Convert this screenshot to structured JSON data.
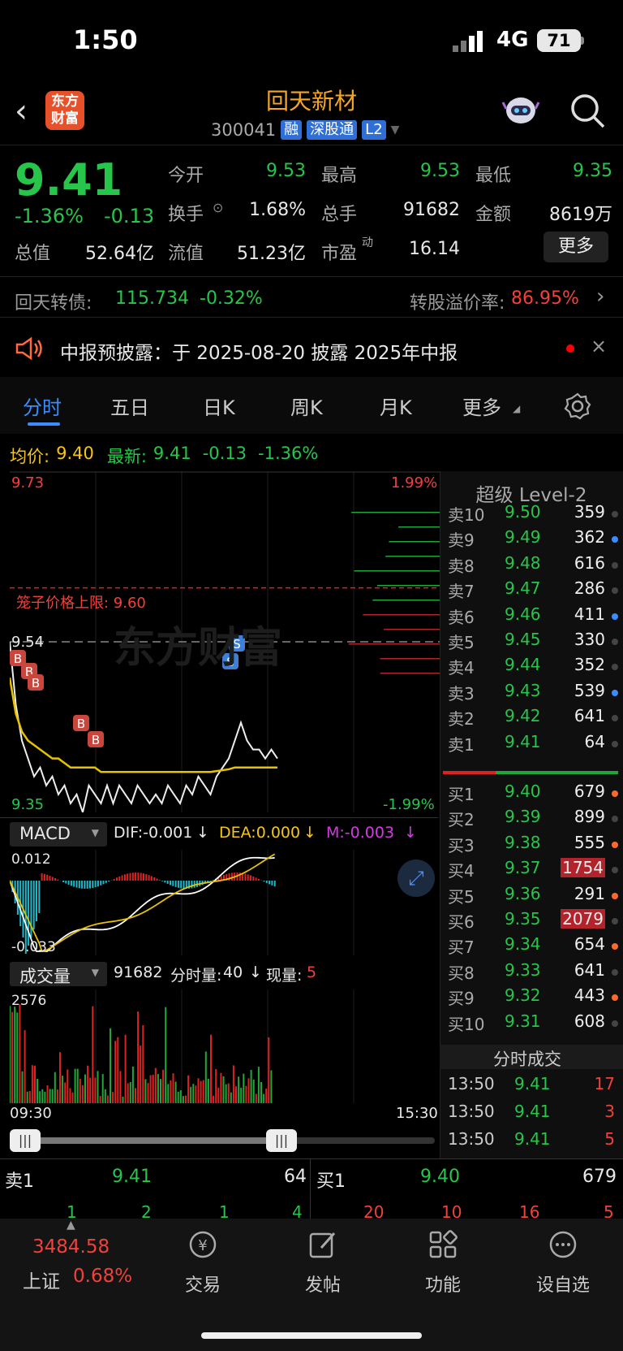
{
  "status": {
    "time": "1:50",
    "network": "4G",
    "battery": "71"
  },
  "header": {
    "logo": "东方财富",
    "title": "回天新材",
    "code": "300041",
    "tags": [
      "融",
      "深股通",
      "L2"
    ]
  },
  "quote": {
    "price": "9.41",
    "change_pct": "-1.36%",
    "change": "-0.13",
    "open_label": "今开",
    "open": "9.53",
    "high_label": "最高",
    "high": "9.53",
    "low_label": "最低",
    "low": "9.35",
    "turnover_label": "换手",
    "turnover": "1.68%",
    "vol_label": "总手",
    "vol": "91682",
    "amount_label": "金额",
    "amount": "8619万",
    "mcap_label": "总值",
    "mcap": "52.64亿",
    "float_label": "流值",
    "float": "51.23亿",
    "pe_label": "市盈",
    "pe_sup": "动",
    "pe": "16.14",
    "more": "更多"
  },
  "bond": {
    "label": "回天转债:",
    "price": "115.734",
    "pct": "-0.32%",
    "premium_label": "转股溢价率:",
    "premium": "86.95%"
  },
  "notice": {
    "text": "中报预披露：于 2025-08-20 披露 2025年中报"
  },
  "tabs": [
    "分时",
    "五日",
    "日K",
    "周K",
    "月K",
    "更多"
  ],
  "chart_info": {
    "avg_label": "均价:",
    "avg": "9.40",
    "last_label": "最新:",
    "last": "9.41",
    "chg": "-0.13",
    "pct": "-1.36%"
  },
  "chart_labels": {
    "top_price": "9.73",
    "top_pct": "1.99%",
    "limit": "笼子价格上限: 9.60",
    "mid": "9.54",
    "bottom_price": "9.35",
    "bottom_pct": "-1.99%",
    "watermark": "东方财富",
    "t_start": "09:30",
    "t_end": "15:30"
  },
  "chart_data": {
    "type": "line",
    "series": [
      {
        "values": [
          9.54,
          9.47,
          9.43,
          9.41,
          9.39,
          9.4,
          9.38,
          9.39,
          9.37,
          9.38,
          9.36,
          9.37,
          9.35,
          9.38,
          9.37,
          9.36,
          9.38,
          9.36,
          9.38,
          9.37,
          9.36,
          9.38,
          9.37,
          9.36,
          9.37,
          9.36,
          9.38,
          9.37,
          9.36,
          9.38,
          9.37,
          9.39,
          9.38,
          9.37,
          9.39,
          9.4,
          9.41,
          9.43,
          9.45,
          9.43,
          9.42,
          9.42,
          9.41,
          9.42,
          9.41
        ]
      },
      {
        "values": [
          9.5,
          9.46,
          9.44,
          9.43,
          9.425,
          9.42,
          9.415,
          9.41,
          9.41,
          9.405,
          9.4,
          9.4,
          9.4,
          9.4,
          9.4,
          9.395,
          9.395,
          9.395,
          9.395,
          9.395,
          9.395,
          9.395,
          9.395,
          9.395,
          9.395,
          9.395,
          9.395,
          9.395,
          9.395,
          9.395,
          9.395,
          9.395,
          9.395,
          9.395,
          9.396,
          9.397,
          9.398,
          9.4,
          9.4,
          9.4,
          9.4,
          9.4,
          9.4,
          9.4,
          9.4
        ]
      }
    ],
    "ylim": [
      9.35,
      9.73
    ]
  },
  "macd": {
    "label": "MACD",
    "dif": "DIF:-0.001",
    "dea": "DEA:0.000",
    "m": "M:-0.003",
    "top": "0.012",
    "bottom": "-0.033"
  },
  "volume": {
    "label": "成交量",
    "total": "91682",
    "minute_label": "分时量:",
    "minute": "40",
    "now_label": "现量:",
    "now": "5",
    "top": "2576"
  },
  "level2": {
    "title": "超级 Level-2",
    "asks": [
      {
        "n": "卖10",
        "p": "9.50",
        "v": "359"
      },
      {
        "n": "卖9",
        "p": "9.49",
        "v": "362"
      },
      {
        "n": "卖8",
        "p": "9.48",
        "v": "616"
      },
      {
        "n": "卖7",
        "p": "9.47",
        "v": "286"
      },
      {
        "n": "卖6",
        "p": "9.46",
        "v": "411"
      },
      {
        "n": "卖5",
        "p": "9.45",
        "v": "330"
      },
      {
        "n": "卖4",
        "p": "9.44",
        "v": "352"
      },
      {
        "n": "卖3",
        "p": "9.43",
        "v": "539"
      },
      {
        "n": "卖2",
        "p": "9.42",
        "v": "641"
      },
      {
        "n": "卖1",
        "p": "9.41",
        "v": "64"
      }
    ],
    "bids": [
      {
        "n": "买1",
        "p": "9.40",
        "v": "679"
      },
      {
        "n": "买2",
        "p": "9.39",
        "v": "899"
      },
      {
        "n": "买3",
        "p": "9.38",
        "v": "555"
      },
      {
        "n": "买4",
        "p": "9.37",
        "v": "1754"
      },
      {
        "n": "买5",
        "p": "9.36",
        "v": "291"
      },
      {
        "n": "买6",
        "p": "9.35",
        "v": "2079"
      },
      {
        "n": "买7",
        "p": "9.34",
        "v": "654"
      },
      {
        "n": "买8",
        "p": "9.33",
        "v": "641"
      },
      {
        "n": "买9",
        "p": "9.32",
        "v": "443"
      },
      {
        "n": "买10",
        "p": "9.31",
        "v": "608"
      }
    ],
    "ticks_title": "分时成交",
    "ticks": [
      {
        "t": "13:50",
        "p": "9.41",
        "v": "17"
      },
      {
        "t": "13:50",
        "p": "9.41",
        "v": "3"
      },
      {
        "t": "13:50",
        "p": "9.41",
        "v": "5"
      }
    ]
  },
  "bottom_quote": {
    "sell_label": "卖1",
    "sell_price": "9.41",
    "sell_vol": "64",
    "buy_label": "买1",
    "buy_price": "9.40",
    "buy_vol": "679",
    "sell_queue": [
      "1",
      "2",
      "1",
      "4"
    ],
    "buy_queue": [
      "20",
      "10",
      "16",
      "5"
    ]
  },
  "nav": {
    "index_value": "3484.58",
    "index_name": "上证",
    "index_pct": "0.68%",
    "items": [
      "交易",
      "发帖",
      "功能",
      "设自选"
    ]
  }
}
